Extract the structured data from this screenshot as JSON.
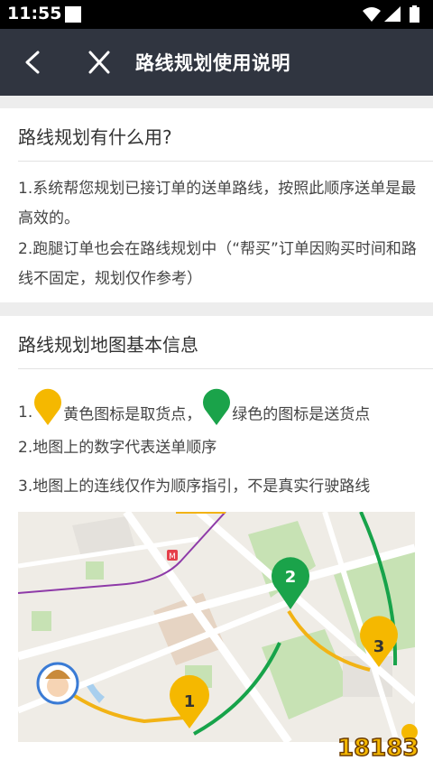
{
  "status": {
    "time": "11:55",
    "icons": [
      "wifi-icon",
      "signal-icon",
      "battery-icon"
    ]
  },
  "nav": {
    "title": "路线规划使用说明",
    "back_icon": "back-arrow-icon",
    "close_icon": "close-icon"
  },
  "section1": {
    "title": "路线规划有什么用?",
    "items": [
      "1.系统帮您规划已接订单的送单路线，按照此顺序送单是最高效的。",
      "2.跑腿订单也会在路线规划中（“帮买”订单因购买时间和路线不固定，规划仅作参考）"
    ]
  },
  "section2": {
    "title": "路线规划地图基本信息",
    "legend": {
      "prefix": "1.",
      "yellow_text": "黄色图标是取货点，",
      "green_text": "绿色的图标是送货点"
    },
    "items": [
      "2.地图上的数字代表送单顺序",
      "3.地图上的连线仅作为顺序指引，不是真实行驶路线"
    ]
  },
  "map": {
    "markers": [
      {
        "label": "1",
        "kind": "pickup"
      },
      {
        "label": "2",
        "kind": "delivery"
      },
      {
        "label": "3",
        "kind": "pickup"
      }
    ],
    "subway_icon": "M"
  },
  "watermark": {
    "text": "18183"
  },
  "colors": {
    "nav_bg": "#303540",
    "pickup_yellow": "#f5b800",
    "delivery_green": "#1aa34a",
    "route_yellow": "#f2b315",
    "route_green": "#17a34a"
  }
}
